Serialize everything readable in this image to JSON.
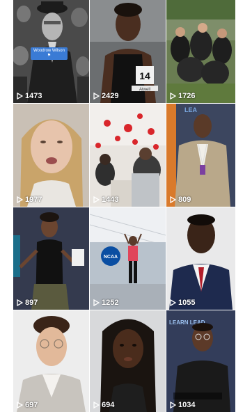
{
  "videos": [
    {
      "views": "1473",
      "caption": "Woodrow Wilson",
      "caption_sub": "⚑"
    },
    {
      "views": "2429",
      "bib": "14",
      "bib_name": "Atwell"
    },
    {
      "views": "1726"
    },
    {
      "views": "1977"
    },
    {
      "views": "1443"
    },
    {
      "views": "809",
      "logo_text": "LEA"
    },
    {
      "views": "897"
    },
    {
      "views": "1252",
      "logo_text": "NCAA"
    },
    {
      "views": "1055"
    },
    {
      "views": "697"
    },
    {
      "views": "694"
    },
    {
      "views": "1034",
      "logo_text": "LEARN LEAD"
    }
  ],
  "colors": {
    "overlay_text": "#ffffff",
    "tag_blue": "#3a7bd5"
  },
  "icons": {
    "play": "play-icon"
  }
}
